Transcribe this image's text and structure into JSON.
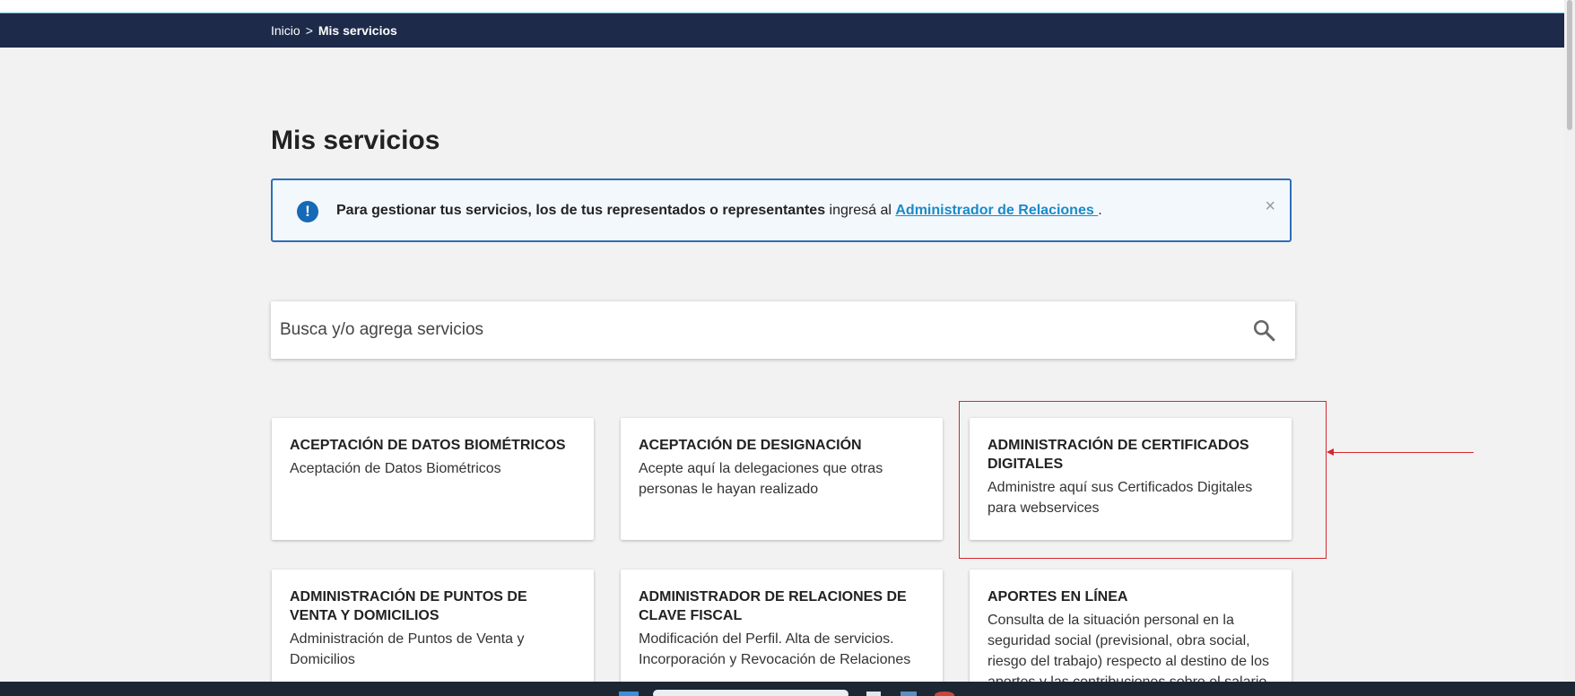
{
  "breadcrumb": {
    "home": "Inicio",
    "separator": ">",
    "current": "Mis servicios"
  },
  "page": {
    "title": "Mis servicios"
  },
  "alert": {
    "bold_text": "Para gestionar tus servicios, los de tus representados o representantes",
    "normal_text": " ingresá al ",
    "link_text": "Administrador de Relaciones ",
    "suffix": ".",
    "close": "×"
  },
  "search": {
    "placeholder": "Busca y/o agrega servicios"
  },
  "cards": [
    {
      "title": "ACEPTACIÓN DE DATOS BIOMÉTRICOS",
      "description": "Aceptación de Datos Biométricos"
    },
    {
      "title": "ACEPTACIÓN DE DESIGNACIÓN",
      "description": "Acepte aquí la delegaciones que otras personas le hayan realizado"
    },
    {
      "title": "ADMINISTRACIÓN DE CERTIFICADOS DIGITALES",
      "description": "Administre aquí sus Certificados Digitales para webservices"
    },
    {
      "title": "ADMINISTRACIÓN DE PUNTOS DE VENTA Y DOMICILIOS",
      "description": "Administración de Puntos de Venta y Domicilios"
    },
    {
      "title": "ADMINISTRADOR DE RELACIONES DE CLAVE FISCAL",
      "description": "Modificación del Perfil. Alta de servicios. Incorporación y Revocación de Relaciones"
    },
    {
      "title": "APORTES EN LÍNEA",
      "description": "Consulta de la situación personal en la seguridad social (previsional, obra social, riesgo del trabajo) respecto al destino de los aportes y las contribuciones sobre el salario"
    }
  ],
  "colors": {
    "navbar": "#1e2a4a",
    "accent": "#4fb5dc",
    "alert_border": "#2d6fb5",
    "link": "#1a8ac8",
    "annotation": "#d9262f"
  }
}
